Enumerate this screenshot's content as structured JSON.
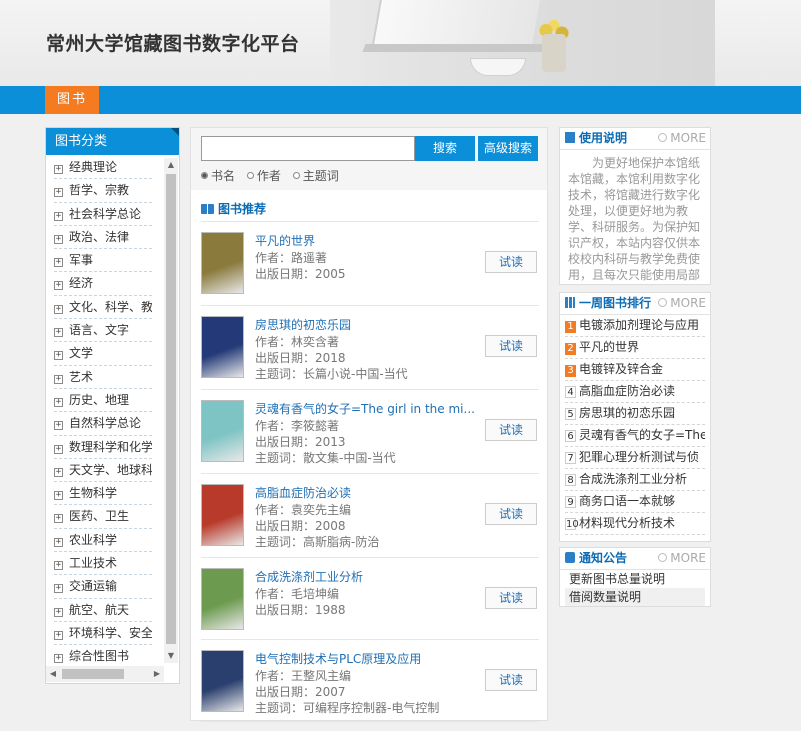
{
  "header": {
    "site_title": "常州大学馆藏图书数字化平台"
  },
  "nav": {
    "tabs": [
      {
        "label": "图书"
      }
    ]
  },
  "categories": {
    "title": "图书分类",
    "items": [
      "经典理论",
      "哲学、宗教",
      "社会科学总论",
      "政治、法律",
      "军事",
      "经济",
      "文化、科学、教育",
      "语言、文字",
      "文学",
      "艺术",
      "历史、地理",
      "自然科学总论",
      "数理科学和化学",
      "天文学、地球科学",
      "生物科学",
      "医药、卫生",
      "农业科学",
      "工业技术",
      "交通运输",
      "航空、航天",
      "环境科学、安全科学",
      "综合性图书"
    ]
  },
  "search": {
    "input_value": "",
    "button_label": "搜索",
    "advanced_label": "高级搜索",
    "types": [
      {
        "label": "书名",
        "checked": true
      },
      {
        "label": "作者",
        "checked": false
      },
      {
        "label": "主题词",
        "checked": false
      }
    ]
  },
  "recommend": {
    "title": "图书推荐",
    "read_label": "试读",
    "books": [
      {
        "title": "平凡的世界",
        "author": "作者：路遥著",
        "date": "出版日期：2005",
        "subject": "",
        "cover_color": "#8a7a3c"
      },
      {
        "title": "房思琪的初恋乐园",
        "author": "作者：林奕含著",
        "date": "出版日期：2018",
        "subject": "主题词：长篇小说-中国-当代",
        "cover_color": "#243a78"
      },
      {
        "title": "灵魂有香气的女子=The girl in the mi...",
        "author": "作者：李筱懿著",
        "date": "出版日期：2013",
        "subject": "主题词：散文集-中国-当代",
        "cover_color": "#7fc4c4"
      },
      {
        "title": "高脂血症防治必读",
        "author": "作者：袁奕先主编",
        "date": "出版日期：2008",
        "subject": "主题词：高斯脂病-防治",
        "cover_color": "#b83a2a"
      },
      {
        "title": "合成洗涤剂工业分析",
        "author": "作者：毛培坤编",
        "date": "出版日期：1988",
        "subject": "",
        "cover_color": "#6c9a4e"
      },
      {
        "title": "电气控制技术与PLC原理及应用",
        "author": "作者：王整风主编",
        "date": "出版日期：2007",
        "subject": "主题词：可编程序控制器-电气控制",
        "cover_color": "#2a3f6e"
      }
    ]
  },
  "usage": {
    "title": "使用说明",
    "more": "MORE",
    "text": "为更好地保护本馆纸本馆藏，本馆利用数字化技术，将馆藏进行数字化处理，以便更好地为教学、科研服务。为保护知识产权，本站内容仅供本校校内科研与教学免费使用，且每次只能使用局部"
  },
  "ranking": {
    "title": "一周图书排行",
    "more": "MORE",
    "items": [
      {
        "num": "1",
        "title": "电镀添加剂理论与应用"
      },
      {
        "num": "2",
        "title": "平凡的世界"
      },
      {
        "num": "3",
        "title": "电镀锌及锌合金"
      },
      {
        "num": "4",
        "title": "高脂血症防治必读"
      },
      {
        "num": "5",
        "title": "房思琪的初恋乐园"
      },
      {
        "num": "6",
        "title": "灵魂有香气的女子=The"
      },
      {
        "num": "7",
        "title": "犯罪心理分析测试与侦"
      },
      {
        "num": "8",
        "title": "合成洗涤剂工业分析"
      },
      {
        "num": "9",
        "title": "商务口语一本就够"
      },
      {
        "num": "10",
        "title": "材料现代分析技术"
      }
    ]
  },
  "notices": {
    "title": "通知公告",
    "more": "MORE",
    "items": [
      "更新图书总量说明",
      "借阅数量说明"
    ]
  }
}
